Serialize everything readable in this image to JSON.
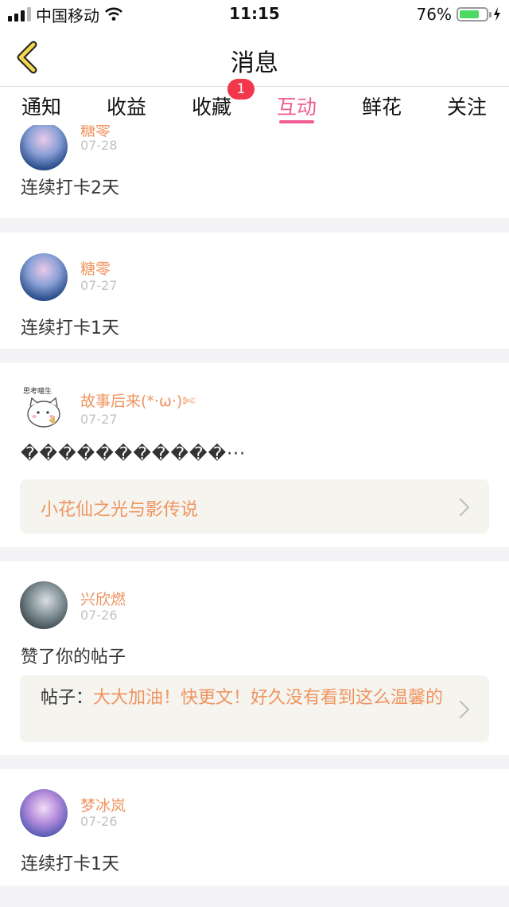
{
  "status_bar": {
    "carrier": "中国移动",
    "time": "11:15",
    "battery_percent": "76%",
    "battery_level": 0.76,
    "icons": [
      "signal-icon",
      "wifi-icon",
      "battery-icon",
      "charging-icon"
    ]
  },
  "header": {
    "title": "消息",
    "back_icon": "chevron-left-icon"
  },
  "tabs": [
    {
      "label": "通知"
    },
    {
      "label": "收益"
    },
    {
      "label": "收藏",
      "badge": "1"
    },
    {
      "label": "互动",
      "active": true
    },
    {
      "label": "鲜花"
    },
    {
      "label": "关注"
    }
  ],
  "colors": {
    "accent": "#ef5d93",
    "username": "#ef9460",
    "badge": "#f2364b",
    "background": "#f4f3f6"
  },
  "feed": [
    {
      "user": "糖零",
      "date": "07-28",
      "text": "连续打卡2天"
    },
    {
      "user": "糖零",
      "date": "07-27",
      "text": "连续打卡1天"
    },
    {
      "user": "故事后来(*·ω·)✄",
      "date": "07-27",
      "text": "�����������···",
      "avatar_text": "思考喵生",
      "ref_title": "小花仙之光与影传说"
    },
    {
      "user": "兴欣燃",
      "date": "07-26",
      "text": "赞了你的帖子",
      "ref_label": "帖子：",
      "ref_title": "大大加油！快更文！好久没有看到这么温馨的"
    },
    {
      "user": "梦冰岚",
      "date": "07-26",
      "text": "连续打卡1天"
    }
  ]
}
